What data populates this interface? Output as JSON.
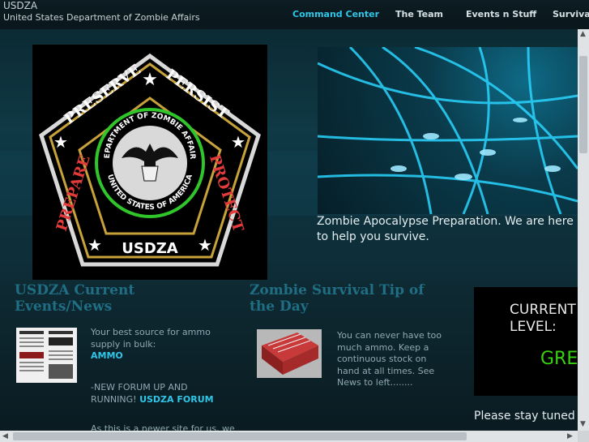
{
  "site": {
    "name": "USDZA",
    "subtitle": "United States Department of Zombie Affairs"
  },
  "nav": {
    "items": [
      "Command Center",
      "The Team",
      "Events n Stuff",
      "Survival"
    ],
    "active": "Command Center"
  },
  "badge": {
    "top_left": "PRESERVE",
    "top_right": "PERSIST",
    "left": "PREPARE",
    "right": "PROTECT",
    "bottom": "USDZA",
    "seal_top": "DEPARTMENT OF ZOMBIE AFFAIRS",
    "seal_bottom": "UNITED STATES OF AMERICA"
  },
  "hero": {
    "caption": "Zombie Apocalypse Preparation. We are here to help you survive."
  },
  "news": {
    "title": "USDZA Current Events/News",
    "intro": "Your best source for ammo supply in bulk:",
    "ammo_link": "AMMO",
    "forum_text": "-NEW FORUM UP AND RUNNING!",
    "forum_link": "USDZA FORUM",
    "more_text": "As this is a newer site for us, we"
  },
  "tip": {
    "title": "Zombie Survival Tip of the Day",
    "text": "You can never have too much ammo. Keep a continuous stock on hand at all times. See News to left........"
  },
  "level": {
    "title": "CURRENT LEVEL:",
    "value": "GREEN",
    "note": "Please stay tuned for"
  },
  "colors": {
    "accent": "#2fc6e8",
    "level_green": "#39d10f",
    "section_title": "#1f6e84"
  }
}
